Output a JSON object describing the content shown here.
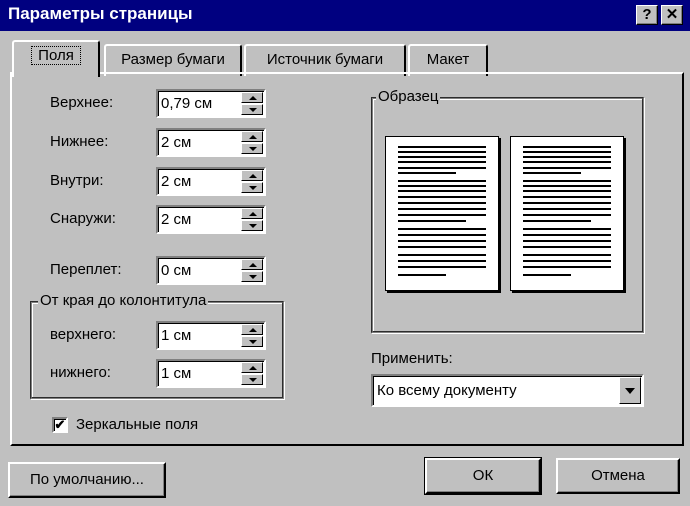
{
  "window": {
    "title": "Параметры страницы",
    "help_button": "?",
    "close_button": "✕"
  },
  "tabs": [
    {
      "label": "Поля",
      "active": true
    },
    {
      "label": "Размер бумаги",
      "active": false
    },
    {
      "label": "Источник бумаги",
      "active": false
    },
    {
      "label": "Макет",
      "active": false
    }
  ],
  "margins": {
    "top_label": "Верхнее:",
    "top_value": "0,79 см",
    "bottom_label": "Нижнее:",
    "bottom_value": "2 см",
    "inside_label": "Внутри:",
    "inside_value": "2 см",
    "outside_label": "Снаружи:",
    "outside_value": "2 см",
    "gutter_label": "Переплет:",
    "gutter_value": "0 см"
  },
  "header_footer": {
    "group_title": "От края до колонтитула",
    "header_label": "верхнего:",
    "header_value": "1 см",
    "footer_label": "нижнего:",
    "footer_value": "1 см"
  },
  "mirror": {
    "label": "Зеркальные поля",
    "checked": true,
    "mark": "✔"
  },
  "preview": {
    "group_title": "Образец"
  },
  "apply": {
    "label": "Применить:",
    "value": "Ко всему документу"
  },
  "buttons": {
    "default": "По умолчанию...",
    "ok": "ОК",
    "cancel": "Отмена"
  }
}
